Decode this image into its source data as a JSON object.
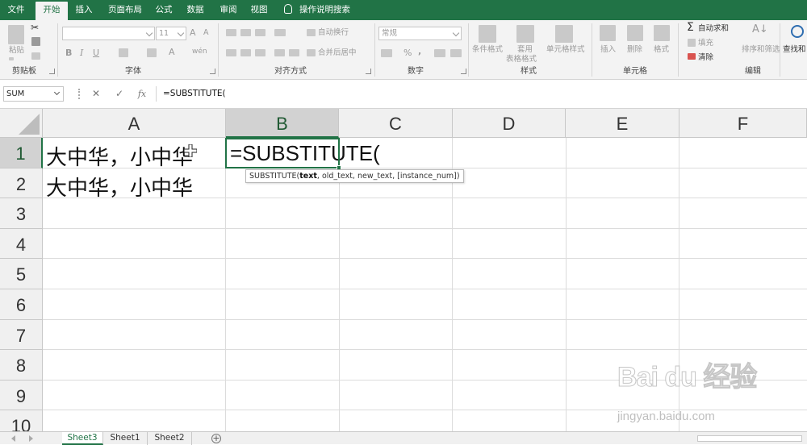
{
  "ribbon_tabs": [
    {
      "label": "文件",
      "active": false
    },
    {
      "label": "开始",
      "active": true
    },
    {
      "label": "插入",
      "active": false
    },
    {
      "label": "页面布局",
      "active": false
    },
    {
      "label": "公式",
      "active": false
    },
    {
      "label": "数据",
      "active": false
    },
    {
      "label": "审阅",
      "active": false
    },
    {
      "label": "视图",
      "active": false
    }
  ],
  "tell_me": "操作说明搜索",
  "ribbon": {
    "clipboard": {
      "paste": "粘贴",
      "group": "剪贴板"
    },
    "font": {
      "name": "",
      "size": "11",
      "grow": "A",
      "shrink": "A",
      "bold": "B",
      "italic": "I",
      "underline": "U",
      "font_color": "A",
      "phonetic": "wén",
      "group": "字体"
    },
    "alignment": {
      "wrap": "自动换行",
      "merge": "合并后居中",
      "group": "对齐方式"
    },
    "number": {
      "format": "常规",
      "percent": "%",
      "comma": ",",
      "group": "数字"
    },
    "styles": {
      "conditional": "条件格式",
      "table_line1": "套用",
      "table_line2": "表格格式",
      "cell_styles": "单元格样式",
      "group": "样式"
    },
    "cells": {
      "insert": "插入",
      "delete": "删除",
      "format": "格式",
      "group": "单元格"
    },
    "editing": {
      "autosum": "自动求和",
      "fill": "填充",
      "clear": "清除",
      "sort": "排序和筛选",
      "find": "查找和",
      "group": "编辑"
    }
  },
  "formula_bar": {
    "name_box": "SUM",
    "cancel": "✕",
    "enter": "✓",
    "fx": "fx",
    "content": "=SUBSTITUTE("
  },
  "sheet": {
    "columns": [
      "A",
      "B",
      "C",
      "D",
      "E",
      "F"
    ],
    "rows": [
      "1",
      "2",
      "3",
      "4",
      "5",
      "6",
      "7",
      "8",
      "9",
      "10"
    ],
    "selected_column": "B",
    "selected_row": "1",
    "cells": {
      "A1": "大中华，小中华",
      "A2": "大中华，小中华",
      "B1": "=SUBSTITUTE("
    },
    "tooltip": {
      "fn": "SUBSTITUTE(",
      "arg1": "text",
      "rest": ", old_text, new_text, [instance_num])"
    }
  },
  "sheet_tabs": [
    {
      "label": "Sheet3",
      "active": true
    },
    {
      "label": "Sheet1",
      "active": false
    },
    {
      "label": "Sheet2",
      "active": false
    }
  ],
  "add_sheet": "+",
  "watermark": {
    "brand": "Bai du 经验",
    "url": "jingyan.baidu.com"
  },
  "colors": {
    "accent": "#217346",
    "ribbon_bg": "#f3f3f3",
    "header_bg": "#f0f0f0"
  }
}
